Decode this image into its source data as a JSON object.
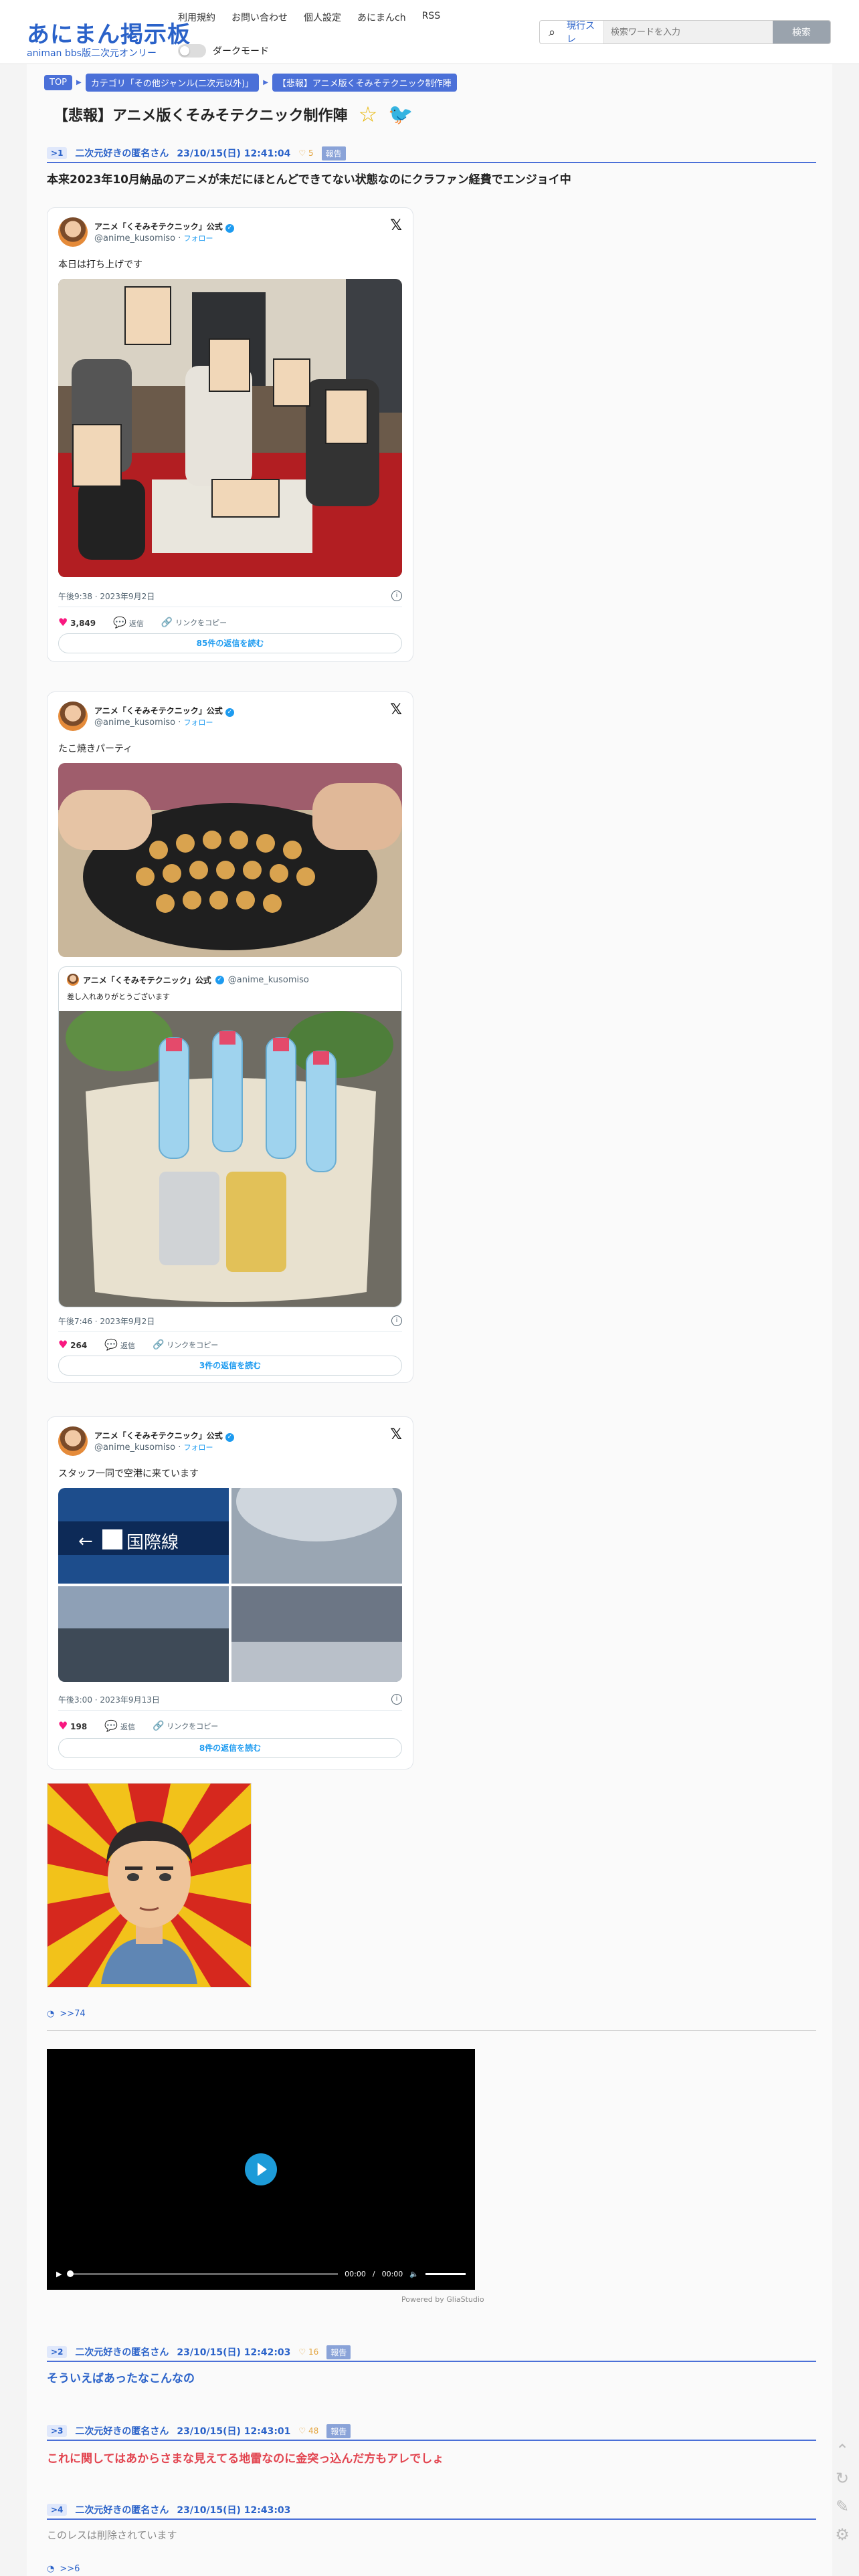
{
  "header": {
    "logo_main": "あにまん掲示板",
    "logo_sub": "animan bbs版二次元オンリー",
    "nav": [
      "利用規約",
      "お問い合わせ",
      "個人設定",
      "あにまんch",
      "RSS"
    ],
    "dark_mode_label": "ダークモード",
    "search": {
      "scope": "現行スレ",
      "placeholder": "検索ワードを入力",
      "button": "検索"
    }
  },
  "breadcrumb": [
    "TOP",
    "カテゴリ「その他ジャンル(二次元以外)」",
    "【悲報】アニメ版くそみそテクニック制作陣"
  ],
  "thread_title": "【悲報】アニメ版くそみそテクニック制作陣",
  "posts": [
    {
      "no": "1",
      "name": "二次元好きの匿名さん",
      "date": "23/10/15(日) 12:41:04",
      "likes": "5",
      "report": "報告",
      "text": "本来2023年10月納品のアニメが未だにほとんどできてない状態なのにクラファン経費でエンジョイ中",
      "reply_link": ">>74"
    },
    {
      "no": "2",
      "name": "二次元好きの匿名さん",
      "date": "23/10/15(日) 12:42:03",
      "likes": "16",
      "report": "報告",
      "text": "そういえばあったなこんなの"
    },
    {
      "no": "3",
      "name": "二次元好きの匿名さん",
      "date": "23/10/15(日) 12:43:01",
      "likes": "48",
      "report": "報告",
      "text": "これに関してはあからさまな見えてる地雷なのに金突っ込んだ方もアレでしょ"
    },
    {
      "no": "4",
      "name": "二次元好きの匿名さん",
      "date": "23/10/15(日) 12:43:03",
      "text": "このレスは削除されています",
      "reply_link": ">>6"
    }
  ],
  "tweets": [
    {
      "name": "アニメ「くそみそテクニック」公式",
      "handle": "@anime_kusomiso",
      "follow": "フォロー",
      "text": "本日は打ち上げです",
      "time": "午後9:38 · 2023年9月2日",
      "likes": "3,849",
      "reply": "返信",
      "copy": "リンクをコピー",
      "more": "85件の返信を読む"
    },
    {
      "name": "アニメ「くそみそテクニック」公式",
      "handle": "@anime_kusomiso",
      "follow": "フォロー",
      "text": "たこ焼きパーティ",
      "quote_name": "アニメ「くそみそテクニック」公式",
      "quote_handle": "@anime_kusomiso",
      "quote_text": "差し入れありがとうございます",
      "time": "午後7:46 · 2023年9月2日",
      "likes": "264",
      "reply": "返信",
      "copy": "リンクをコピー",
      "more": "3件の返信を読む"
    },
    {
      "name": "アニメ「くそみそテクニック」公式",
      "handle": "@anime_kusomiso",
      "follow": "フォロー",
      "text": "スタッフ一同で空港に来ています",
      "sign": "国際線",
      "time": "午後3:00 · 2023年9月13日",
      "likes": "198",
      "reply": "返信",
      "copy": "リンクをコピー",
      "more": "8件の返信を読む"
    }
  ],
  "video": {
    "time": "00:00",
    "duration": "00:00",
    "powered": "Powered by GliaStudio"
  },
  "colors": {
    "accent": "#2a62c9",
    "twitter": "#1d9bf0",
    "heart": "#f91880",
    "red_text": "#e2444f"
  }
}
